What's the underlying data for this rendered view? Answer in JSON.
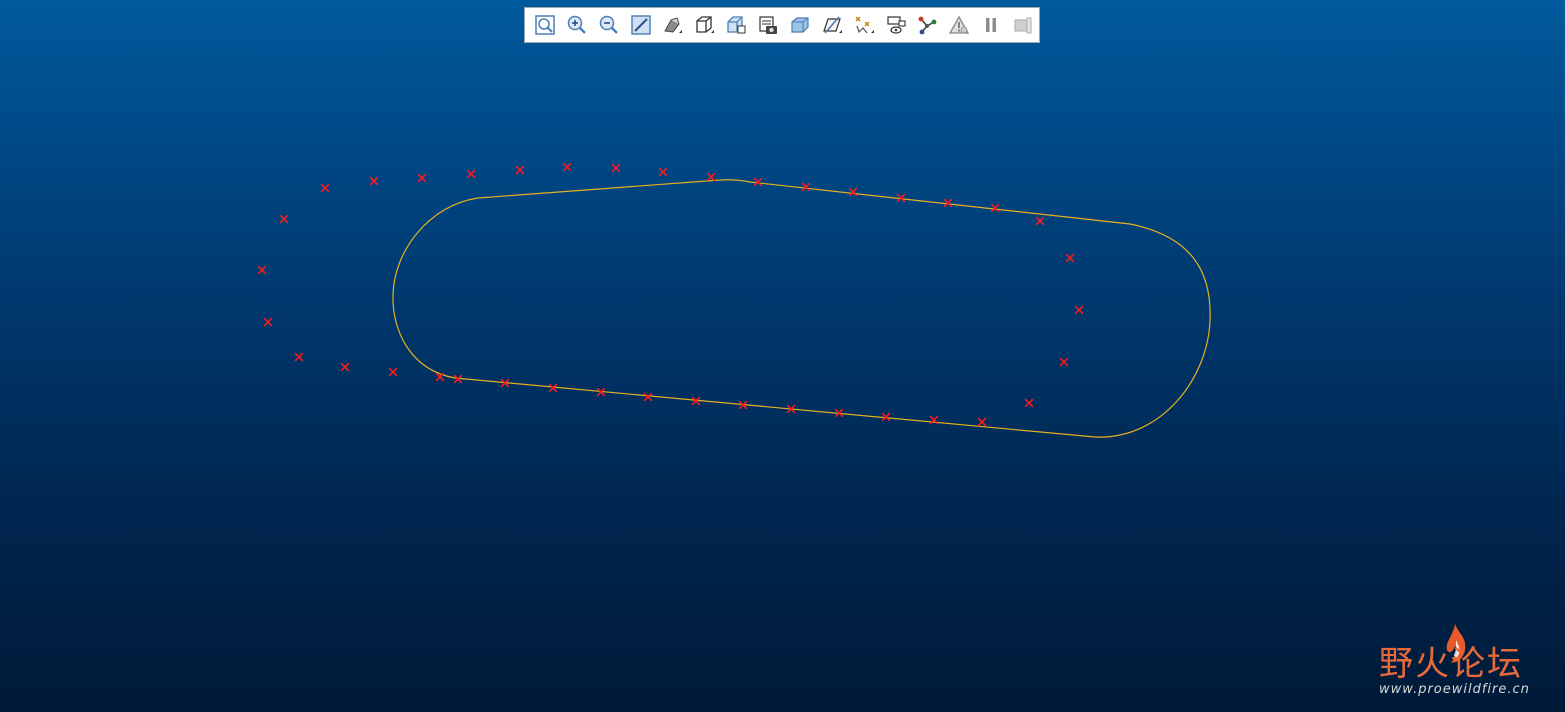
{
  "toolbar": {
    "buttons": [
      {
        "icon": "refit-icon",
        "color": "#4a7fb5"
      },
      {
        "icon": "zoom-in-icon",
        "color": "#4a7fb5"
      },
      {
        "icon": "zoom-out-icon",
        "color": "#4a7fb5"
      },
      {
        "icon": "repaint-icon",
        "color": "#4a7fb5"
      },
      {
        "icon": "display-style-icon",
        "color": "#555555"
      },
      {
        "icon": "saved-orientations-icon",
        "color": "#333333"
      },
      {
        "icon": "view-manager-icon",
        "color": "#4a7fb5"
      },
      {
        "icon": "perspective-icon",
        "color": "#333333"
      },
      {
        "icon": "section-icon",
        "color": "#4a7fb5"
      },
      {
        "icon": "datum-display-icon",
        "color": "#333333"
      },
      {
        "icon": "annotation-display-icon",
        "color": "#b8860b"
      },
      {
        "icon": "spin-center-icon",
        "color": "#333333"
      },
      {
        "icon": "skeleton-icon",
        "color": "#c0392b"
      },
      {
        "icon": "warning-icon",
        "color": "#888888"
      },
      {
        "icon": "pause-icon",
        "color": "#888888"
      },
      {
        "icon": "next-icon",
        "color": "#aaaaaa"
      }
    ]
  },
  "sketch": {
    "curve_color": "#e8b020",
    "marker_color": "#ff1a1a"
  },
  "watermark": {
    "title": "野火论坛",
    "url": "www.proewildfire.cn",
    "title_color": "#e86a3a",
    "flame_color": "#e85a2a"
  }
}
